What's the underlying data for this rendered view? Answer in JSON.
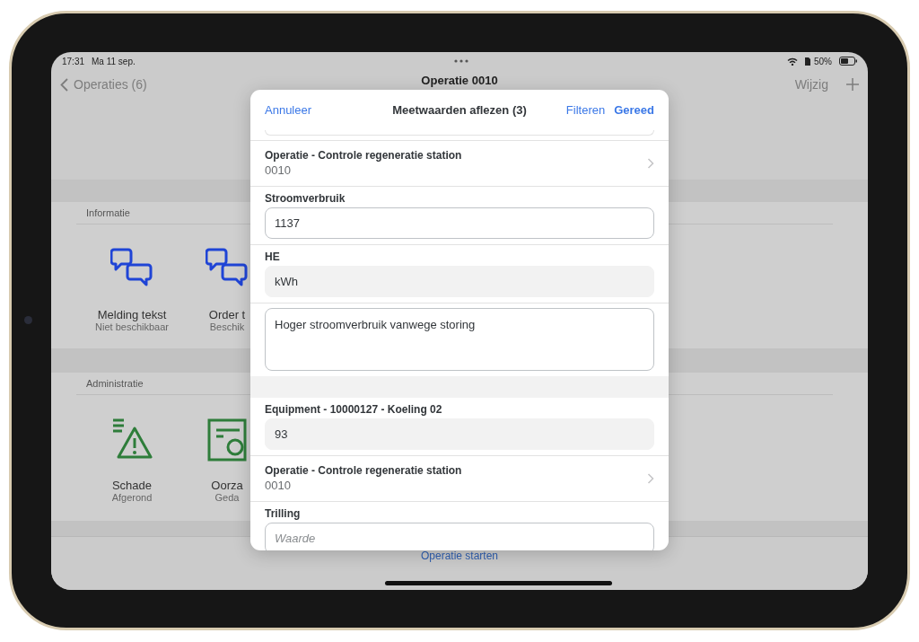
{
  "status_bar": {
    "time": "17:31",
    "date": "Ma 11 sep.",
    "battery": "50%"
  },
  "nav_bar": {
    "back": "Operaties (6)",
    "title": "Operatie 0010",
    "edit": "Wijzig"
  },
  "sections": [
    {
      "title": "Informatie",
      "tiles": [
        {
          "kind": "chat",
          "title": "Melding tekst",
          "subtitle": "Niet beschikbaar"
        },
        {
          "kind": "chat",
          "title": "Order t",
          "subtitle": "Beschik"
        }
      ]
    },
    {
      "title": "Administratie",
      "tiles": [
        {
          "kind": "warning",
          "title": "Schade",
          "subtitle": "Afgerond"
        },
        {
          "kind": "document",
          "title": "Oorza",
          "subtitle": "Geda"
        }
      ]
    }
  ],
  "toolbar": {
    "action": "Operatie starten"
  },
  "dialog": {
    "cancel": "Annuleer",
    "title": "Meetwaarden aflezen (3)",
    "filter": "Filteren",
    "done": "Gereed",
    "rows": [
      {
        "kind": "link",
        "title": "Operatie - Controle regeneratie station",
        "value": "0010"
      },
      {
        "kind": "input",
        "label": "Stroomverbruik",
        "value": "1137",
        "editable": true
      },
      {
        "kind": "input",
        "label": "HE",
        "value": "kWh",
        "editable": false
      },
      {
        "kind": "textarea",
        "value": "Hoger stroomverbruik vanwege storing",
        "editable": true
      },
      {
        "kind": "group_break"
      },
      {
        "kind": "input",
        "label": "Equipment - 10000127 - Koeling 02",
        "value": "93",
        "editable": false
      },
      {
        "kind": "link",
        "title": "Operatie - Controle regeneratie station",
        "value": "0010"
      },
      {
        "kind": "input",
        "label": "Trilling",
        "placeholder": "Waarde",
        "editable": true
      }
    ]
  }
}
